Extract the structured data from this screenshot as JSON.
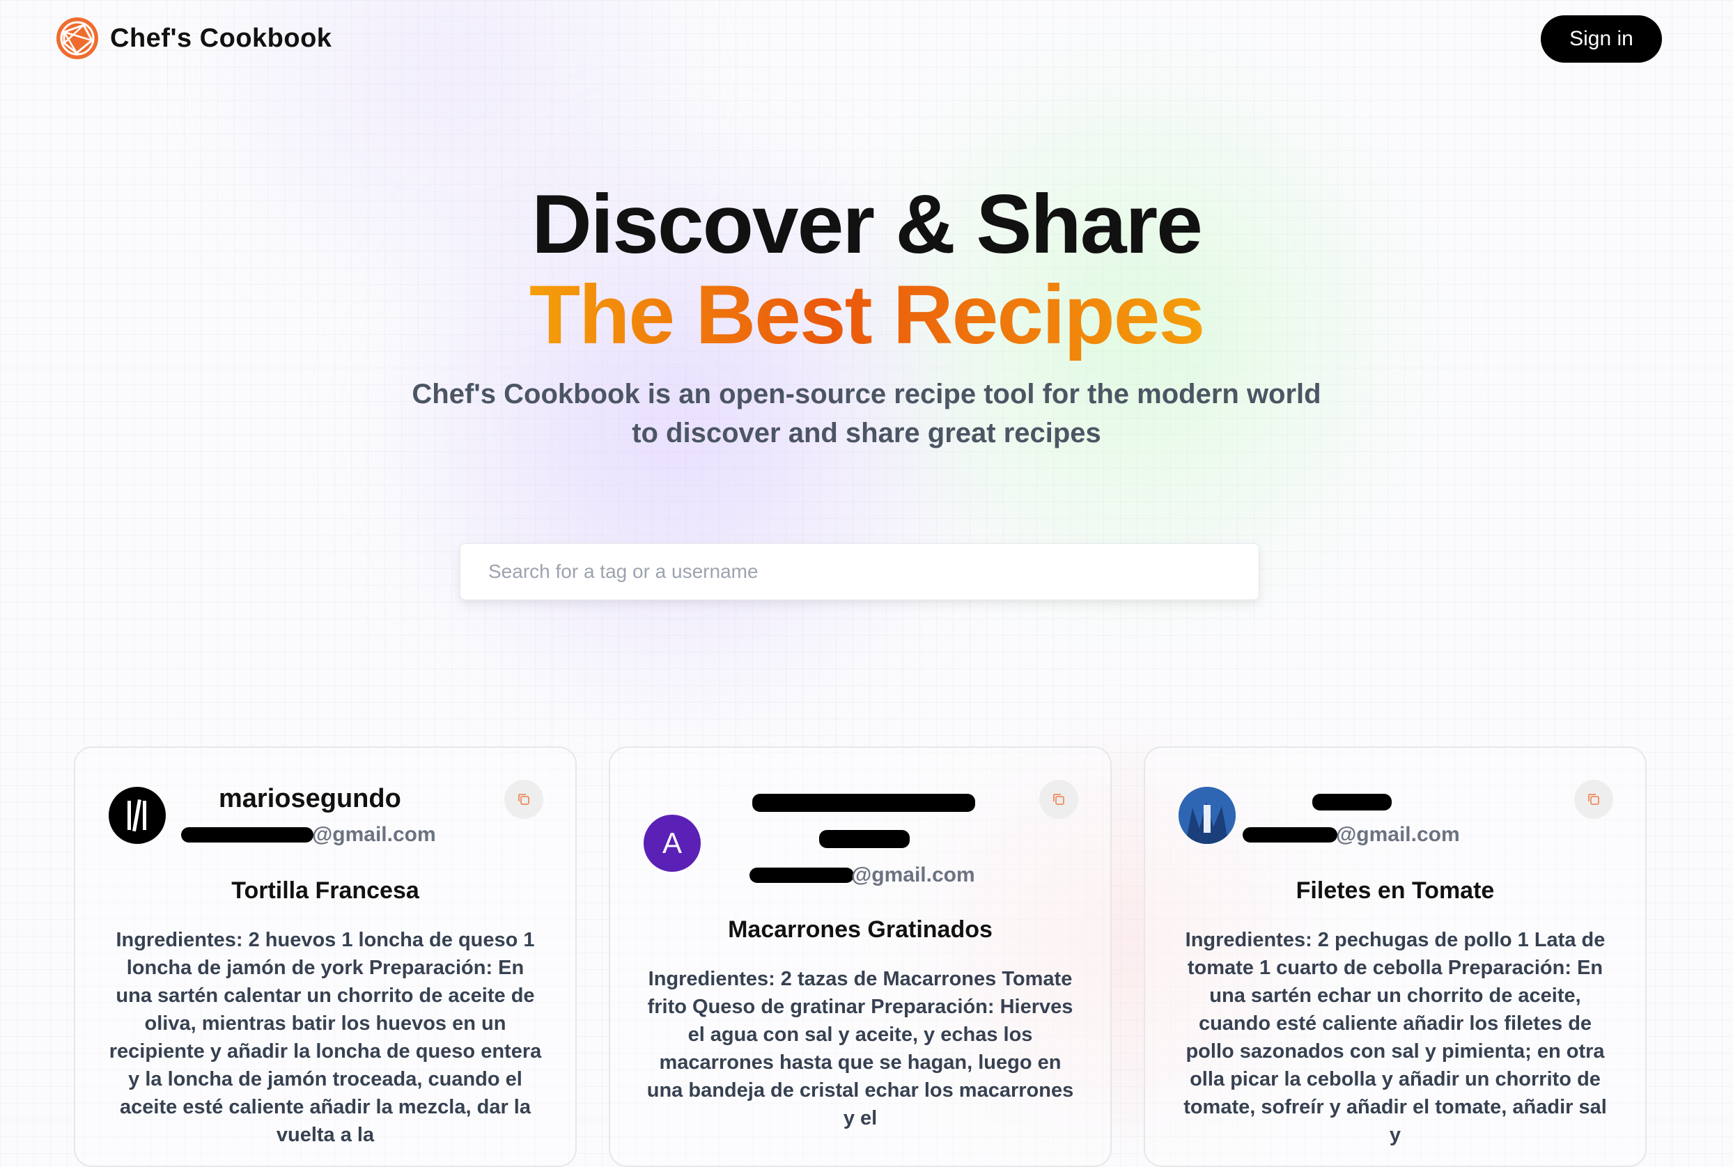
{
  "app": {
    "brand": "Chef's Cookbook",
    "signin_label": "Sign in"
  },
  "hero": {
    "line1": "Discover & Share",
    "line2": "The Best Recipes",
    "subtitle_line1": "Chef's Cookbook is an open-source recipe tool for the modern world",
    "subtitle_line2": "to discover and share great recipes"
  },
  "search": {
    "placeholder": "Search for a tag or a username",
    "value": ""
  },
  "colors": {
    "accent_orange": "#ea580c",
    "accent_amber": "#f59e0b",
    "avatar_purple": "#5b21b6",
    "button_black": "#000000"
  },
  "cards": [
    {
      "username": "mariosegundo",
      "email_suffix": "@gmail.com",
      "title": "Tortilla Francesa",
      "body": "Ingredientes: 2 huevos 1 loncha de queso 1 loncha de jamón de york Preparación: En una sartén calentar un chorrito de aceite de oliva, mientras batir los huevos en un recipiente y añadir la loncha de queso entera y la loncha de jamón troceada, cuando el aceite esté caliente añadir la mezcla, dar la vuelta a la",
      "avatar_icon": "bars-logo-icon"
    },
    {
      "username": "",
      "avatar_letter": "A",
      "email_suffix": "@gmail.com",
      "title": "Macarrones Gratinados",
      "body": "Ingredientes: 2 tazas de Macarrones Tomate frito Queso de gratinar Preparación: Hierves el agua con sal y aceite, y echas los macarrones hasta que se hagan, luego en una bandeja de cristal echar los macarrones y el"
    },
    {
      "username": "",
      "email_suffix": "@gmail.com",
      "title": "Filetes en Tomate",
      "body": "Ingredientes: 2 pechugas de pollo 1 Lata de tomate 1 cuarto de cebolla Preparación: En una sartén echar un chorrito de aceite, cuando esté caliente añadir los filetes de pollo sazonados con sal y pimienta; en otra olla picar la cebolla y añadir un chorrito de tomate, sofreír y añadir el tomate, añadir sal y",
      "avatar_icon": "photo-avatar-icon"
    }
  ],
  "icons": {
    "copy": "copy-icon",
    "logo": "cookbook-logo-icon"
  }
}
